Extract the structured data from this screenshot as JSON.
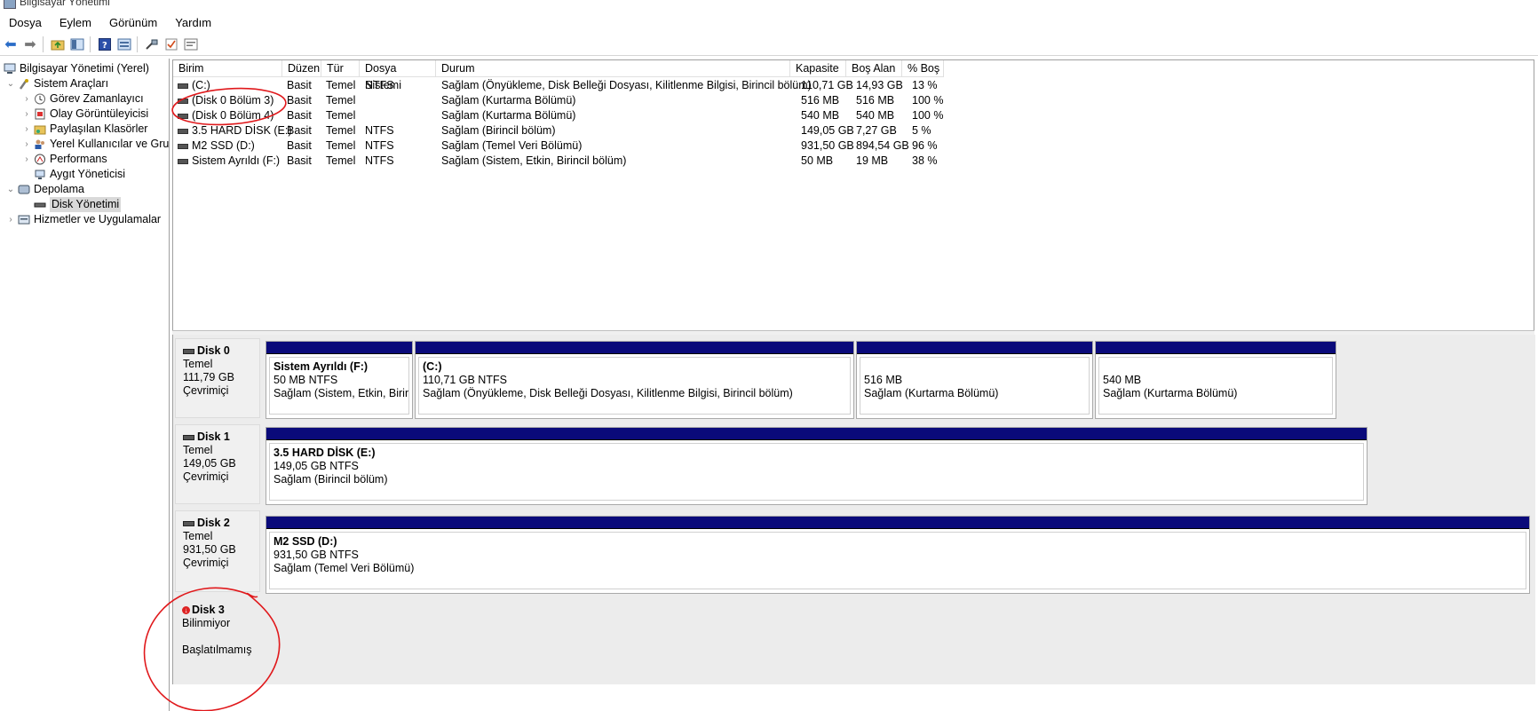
{
  "window": {
    "title": "Bilgisayar Yönetimi"
  },
  "menu": [
    "Dosya",
    "Eylem",
    "Görünüm",
    "Yardım"
  ],
  "toolbar": {
    "icons": [
      "back-arrow-icon",
      "forward-arrow-icon",
      "up-folder-icon",
      "show-hide-tree-icon",
      "help-icon",
      "properties-icon",
      "connect-icon",
      "checklist-icon",
      "console-icon"
    ]
  },
  "tree": {
    "root": "Bilgisayar Yönetimi (Yerel)",
    "system_tools": "Sistem Araçları",
    "task_scheduler": "Görev Zamanlayıcı",
    "event_viewer": "Olay Görüntüleyicisi",
    "shared_folders": "Paylaşılan Klasörler",
    "local_users": "Yerel Kullanıcılar ve Gru",
    "performance": "Performans",
    "device_manager": "Aygıt Yöneticisi",
    "storage": "Depolama",
    "disk_management": "Disk Yönetimi",
    "services": "Hizmetler ve Uygulamalar"
  },
  "volumes": {
    "columns": [
      "Birim",
      "Düzen",
      "Tür",
      "Dosya Sistemi",
      "Durum",
      "Kapasite",
      "Boş Alan",
      "% Boş"
    ],
    "rows": [
      {
        "name": "(C:)",
        "layout": "Basit",
        "type": "Temel",
        "fs": "NTFS",
        "status": "Sağlam (Önyükleme, Disk Belleği Dosyası, Kilitlenme Bilgisi, Birincil bölüm)",
        "capacity": "110,71 GB",
        "free": "14,93 GB",
        "pct": "13 %"
      },
      {
        "name": "(Disk 0 Bölüm 3)",
        "layout": "Basit",
        "type": "Temel",
        "fs": "",
        "status": "Sağlam (Kurtarma Bölümü)",
        "capacity": "516 MB",
        "free": "516 MB",
        "pct": "100 %"
      },
      {
        "name": "(Disk 0 Bölüm 4)",
        "layout": "Basit",
        "type": "Temel",
        "fs": "",
        "status": "Sağlam (Kurtarma Bölümü)",
        "capacity": "540 MB",
        "free": "540 MB",
        "pct": "100 %"
      },
      {
        "name": "3.5 HARD DİSK (E:)",
        "layout": "Basit",
        "type": "Temel",
        "fs": "NTFS",
        "status": "Sağlam (Birincil bölüm)",
        "capacity": "149,05 GB",
        "free": "7,27 GB",
        "pct": "5 %"
      },
      {
        "name": "M2 SSD (D:)",
        "layout": "Basit",
        "type": "Temel",
        "fs": "NTFS",
        "status": "Sağlam (Temel Veri Bölümü)",
        "capacity": "931,50 GB",
        "free": "894,54 GB",
        "pct": "96 %"
      },
      {
        "name": "Sistem Ayrıldı (F:)",
        "layout": "Basit",
        "type": "Temel",
        "fs": "NTFS",
        "status": "Sağlam (Sistem, Etkin, Birincil bölüm)",
        "capacity": "50 MB",
        "free": "19 MB",
        "pct": "38 %"
      }
    ]
  },
  "disks": [
    {
      "name": "Disk 0",
      "type": "Temel",
      "size": "111,79 GB",
      "state": "Çevrimiçi",
      "partitions": [
        {
          "name": "Sistem Ayrıldı  (F:)",
          "size": "50 MB NTFS",
          "status": "Sağlam (Sistem, Etkin, Birinci"
        },
        {
          "name": "(C:)",
          "size": "110,71 GB NTFS",
          "status": "Sağlam (Önyükleme, Disk Belleği Dosyası, Kilitlenme Bilgisi, Birincil bölüm)"
        },
        {
          "name": "",
          "size": "516 MB",
          "status": "Sağlam (Kurtarma Bölümü)"
        },
        {
          "name": "",
          "size": "540 MB",
          "status": "Sağlam (Kurtarma Bölümü)"
        }
      ]
    },
    {
      "name": "Disk 1",
      "type": "Temel",
      "size": "149,05 GB",
      "state": "Çevrimiçi",
      "partitions": [
        {
          "name": "3.5 HARD DİSK  (E:)",
          "size": "149,05 GB NTFS",
          "status": "Sağlam (Birincil bölüm)"
        }
      ]
    },
    {
      "name": "Disk 2",
      "type": "Temel",
      "size": "931,50 GB",
      "state": "Çevrimiçi",
      "partitions": [
        {
          "name": "M2 SSD  (D:)",
          "size": "931,50 GB NTFS",
          "status": "Sağlam (Temel Veri Bölümü)"
        }
      ]
    },
    {
      "name": "Disk 3",
      "type": "Bilinmiyor",
      "size": "",
      "state": "Başlatılmamış",
      "partitions": []
    }
  ],
  "colors": {
    "partition_bar": "#0a0a7a",
    "annotation": "#e0191c",
    "selection": "#d9d9d9"
  }
}
